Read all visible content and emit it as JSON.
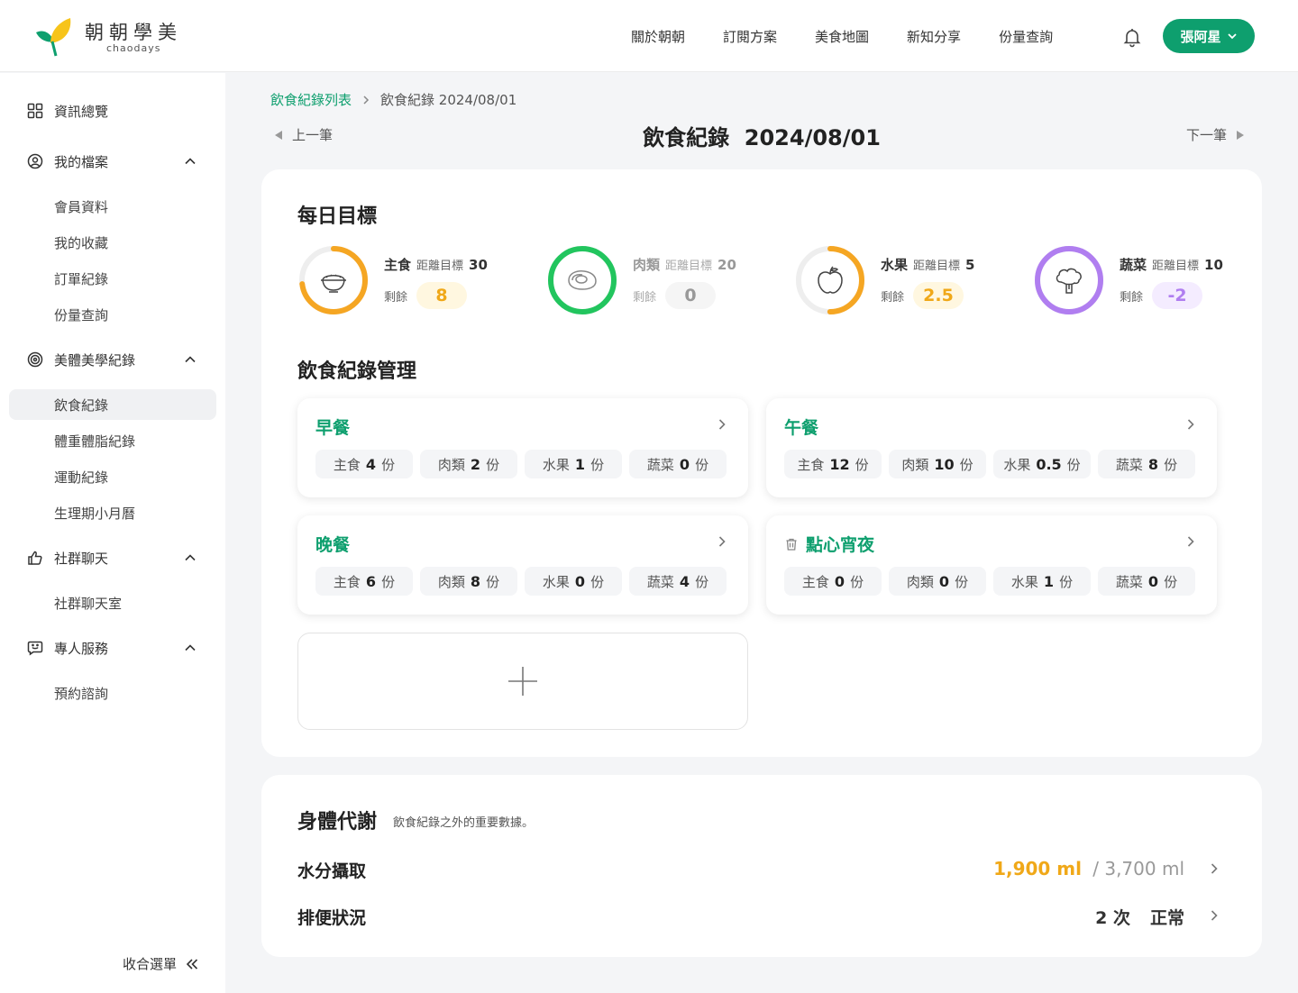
{
  "brand": {
    "name": "朝朝學美",
    "sub": "chaodays",
    "color": "#0e9f6e"
  },
  "nav": [
    "關於朝朝",
    "訂閱方案",
    "美食地圖",
    "新知分享",
    "份量查詢"
  ],
  "user": {
    "name": "張阿星"
  },
  "sidebar": {
    "overview": "資訊總覽",
    "profile": {
      "label": "我的檔案",
      "items": [
        "會員資料",
        "我的收藏",
        "訂單紀錄",
        "份量查詢"
      ]
    },
    "beauty": {
      "label": "美體美學紀錄",
      "items": [
        "飲食紀錄",
        "體重體脂紀錄",
        "運動紀錄",
        "生理期小月曆"
      ]
    },
    "community": {
      "label": "社群聊天",
      "items": [
        "社群聊天室"
      ]
    },
    "service": {
      "label": "專人服務",
      "items": [
        "預約諮詢"
      ]
    },
    "collapse": "收合選單"
  },
  "breadcrumb": {
    "parent": "飲食紀錄列表",
    "current": "飲食紀錄 2024/08/01"
  },
  "pager": {
    "prev": "上一筆",
    "next": "下一筆"
  },
  "page_title": "飲食紀錄  2024/08/01",
  "daily_goal": {
    "title": "每日目標",
    "dist_label": "距離目標",
    "rem_label": "剩餘",
    "goals": [
      {
        "name": "主食",
        "target": "30",
        "remaining": "8",
        "progress": 0.73,
        "color": "#f5a623"
      },
      {
        "name": "肉類",
        "target": "20",
        "remaining": "0",
        "progress": 1.0,
        "color": "#22c55e"
      },
      {
        "name": "水果",
        "target": "5",
        "remaining": "2.5",
        "progress": 0.5,
        "color": "#f5a623"
      },
      {
        "name": "蔬菜",
        "target": "10",
        "remaining": "-2",
        "progress": 1.0,
        "color": "#b07ef0"
      }
    ]
  },
  "meals_section": {
    "title": "飲食紀錄管理",
    "unit": "份",
    "categories": [
      "主食",
      "肉類",
      "水果",
      "蔬菜"
    ],
    "meals": [
      {
        "name": "早餐",
        "values": [
          "4",
          "2",
          "1",
          "0"
        ]
      },
      {
        "name": "午餐",
        "values": [
          "12",
          "10",
          "0.5",
          "8"
        ]
      },
      {
        "name": "晚餐",
        "values": [
          "6",
          "8",
          "0",
          "4"
        ]
      },
      {
        "name": "點心宵夜",
        "values": [
          "0",
          "0",
          "1",
          "0"
        ]
      }
    ]
  },
  "metabolism": {
    "title": "身體代謝",
    "note": "飲食紀錄之外的重要數據。",
    "water": {
      "label": "水分攝取",
      "value": "1,900 ml",
      "total": "/ 3,700 ml"
    },
    "bowel": {
      "label": "排便狀況",
      "count": "2 次",
      "status": "正常"
    }
  }
}
